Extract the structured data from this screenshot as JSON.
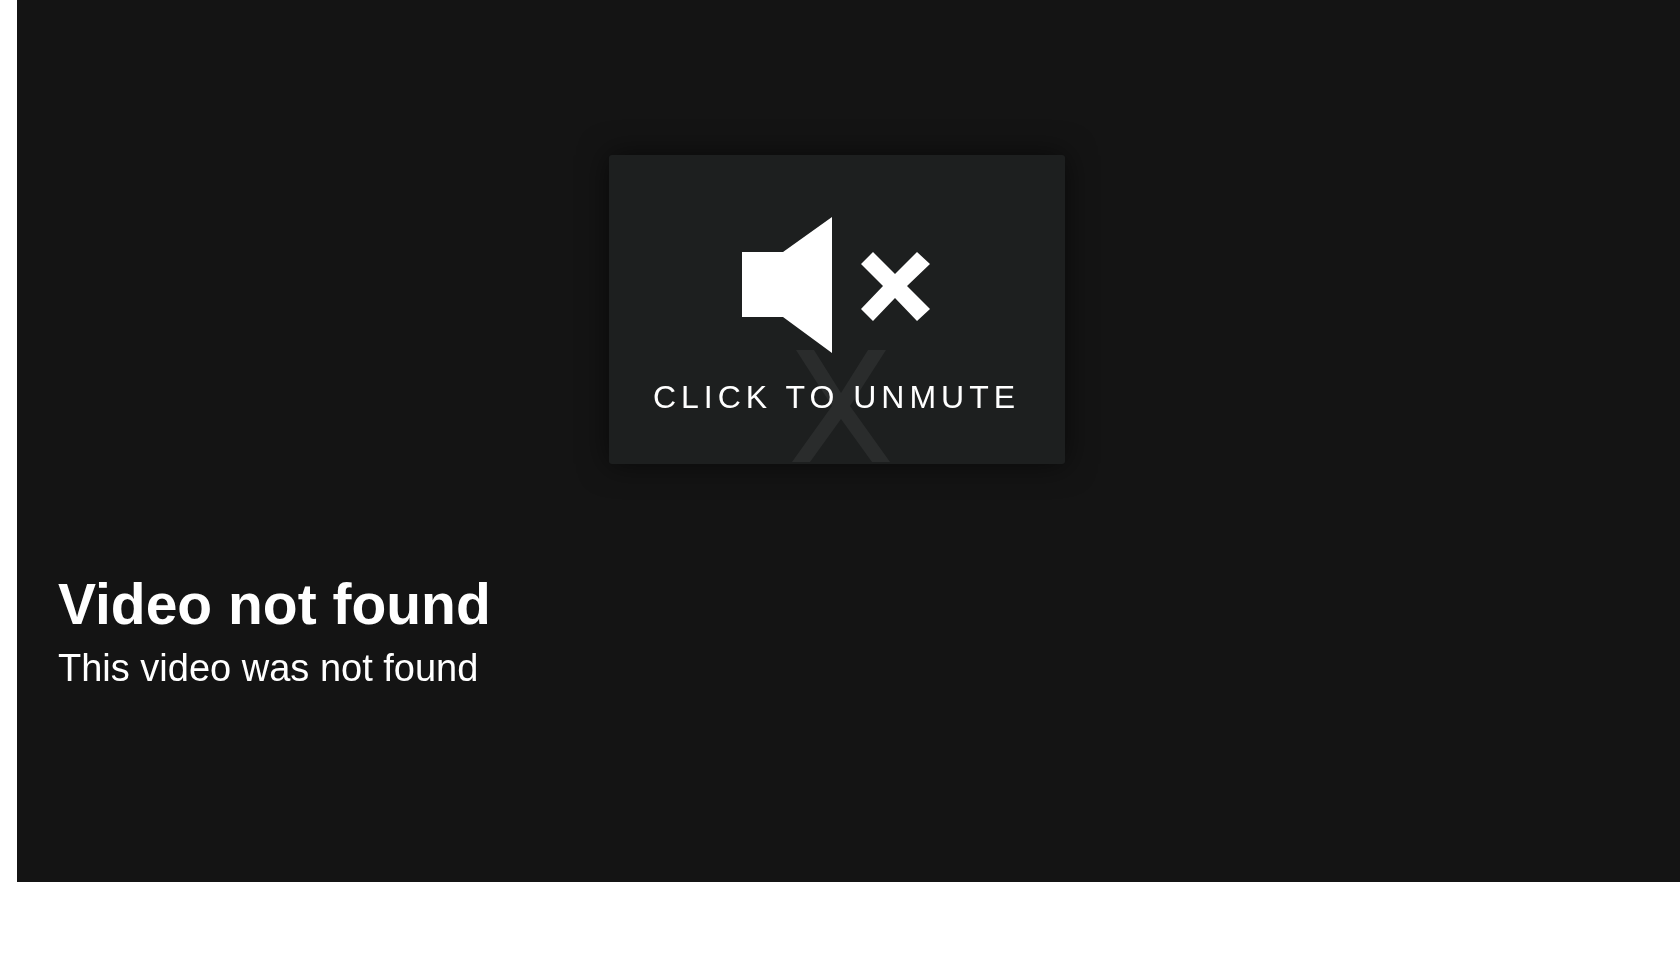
{
  "player": {
    "muted": true,
    "unmute_label": "CLICK TO UNMUTE",
    "error_title": "Video not found",
    "error_message": "This video was not found"
  }
}
